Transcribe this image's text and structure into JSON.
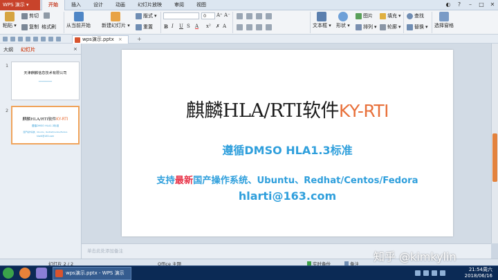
{
  "titlebar": {
    "app_name": "WPS 演示",
    "tabs": [
      {
        "label": "开始",
        "active": true
      },
      {
        "label": "插入"
      },
      {
        "label": "设计"
      },
      {
        "label": "动画"
      },
      {
        "label": "幻灯片放映"
      },
      {
        "label": "审阅"
      },
      {
        "label": "视图"
      }
    ]
  },
  "ribbon": {
    "paste": "粘贴",
    "cut": "剪切",
    "copy": "复制",
    "format_painter": "格式刷",
    "from_current": "从当前开始",
    "new_slide": "新建幻灯片",
    "layout": "版式",
    "reset": "重置",
    "font_size": "0",
    "text_box": "文本框",
    "shape": "形状",
    "picture": "图片",
    "arrange": "排列",
    "fill": "填充",
    "outline": "轮廓",
    "find": "查找",
    "replace": "替换",
    "select_pane": "选择窗格"
  },
  "document_tab": {
    "filename": "wps演示.pptx"
  },
  "sidepanel": {
    "tab_outline": "大纲",
    "tab_slides": "幻灯片",
    "thumb1": {
      "number": "1",
      "title": "天津麒麟信息技术有限公司"
    },
    "thumb2": {
      "number": "2"
    }
  },
  "slide": {
    "title_main": "麒麟HLA/RTI软件",
    "title_accent": "KY-RTI",
    "subtitle": "遵循DMSO HLA1.3标准",
    "support_prefix": "支持",
    "support_highlight": "最新",
    "support_suffix": "国产操作系统、Ubuntu、Redhat/Centos/Fedora",
    "email": "hlarti@163.com"
  },
  "notes": {
    "placeholder": "单击此处添加备注"
  },
  "statusbar": {
    "slide_counter": "幻灯片 2 / 2",
    "theme": "Office 主题",
    "backup": "实时备份",
    "notes_toggle": "备注"
  },
  "taskbar": {
    "task_label": "wps演示.pptx - WPS 演示",
    "time": "21:54周六",
    "date": "2018/06/16"
  },
  "watermark": "知乎 @kimkylin",
  "colors": {
    "accent": "#e8703a",
    "blue_text": "#2f9fdc",
    "highlight": "#e8354a",
    "wps_red": "#c8432b"
  }
}
